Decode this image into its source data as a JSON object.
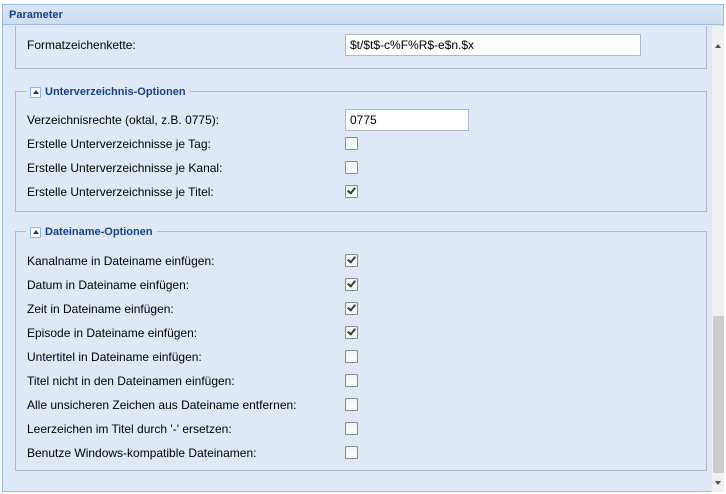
{
  "panel": {
    "title": "Parameter"
  },
  "format": {
    "label": "Formatzeichenkette:",
    "value": "$t/$t$-c%F%R$-e$n.$x"
  },
  "subdir": {
    "title": "Unterverzeichnis-Optionen",
    "rights_label": "Verzeichnisrechte (oktal, z.B. 0775):",
    "rights_value": "0775",
    "options": [
      {
        "label": "Erstelle Unterverzeichnisse je Tag:",
        "checked": false
      },
      {
        "label": "Erstelle Unterverzeichnisse je Kanal:",
        "checked": false
      },
      {
        "label": "Erstelle Unterverzeichnisse je Titel:",
        "checked": true
      }
    ]
  },
  "filename": {
    "title": "Dateiname-Optionen",
    "options": [
      {
        "label": "Kanalname in Dateiname einfügen:",
        "checked": true
      },
      {
        "label": "Datum in Dateiname einfügen:",
        "checked": true
      },
      {
        "label": "Zeit in Dateiname einfügen:",
        "checked": true
      },
      {
        "label": "Episode in Dateiname einfügen:",
        "checked": true
      },
      {
        "label": "Untertitel in Dateiname einfügen:",
        "checked": false
      },
      {
        "label": "Titel nicht in den Dateinamen einfügen:",
        "checked": false
      },
      {
        "label": "Alle unsicheren Zeichen aus Dateiname entfernen:",
        "checked": false
      },
      {
        "label": "Leerzeichen im Titel durch '-' ersetzen:",
        "checked": false
      },
      {
        "label": "Benutze Windows-kompatible Dateinamen:",
        "checked": false
      }
    ]
  },
  "icons": {
    "collapse": "collapse-arrow-icon",
    "scroll_up": "scroll-up-arrow-icon",
    "scroll_down": "scroll-down-arrow-icon"
  }
}
